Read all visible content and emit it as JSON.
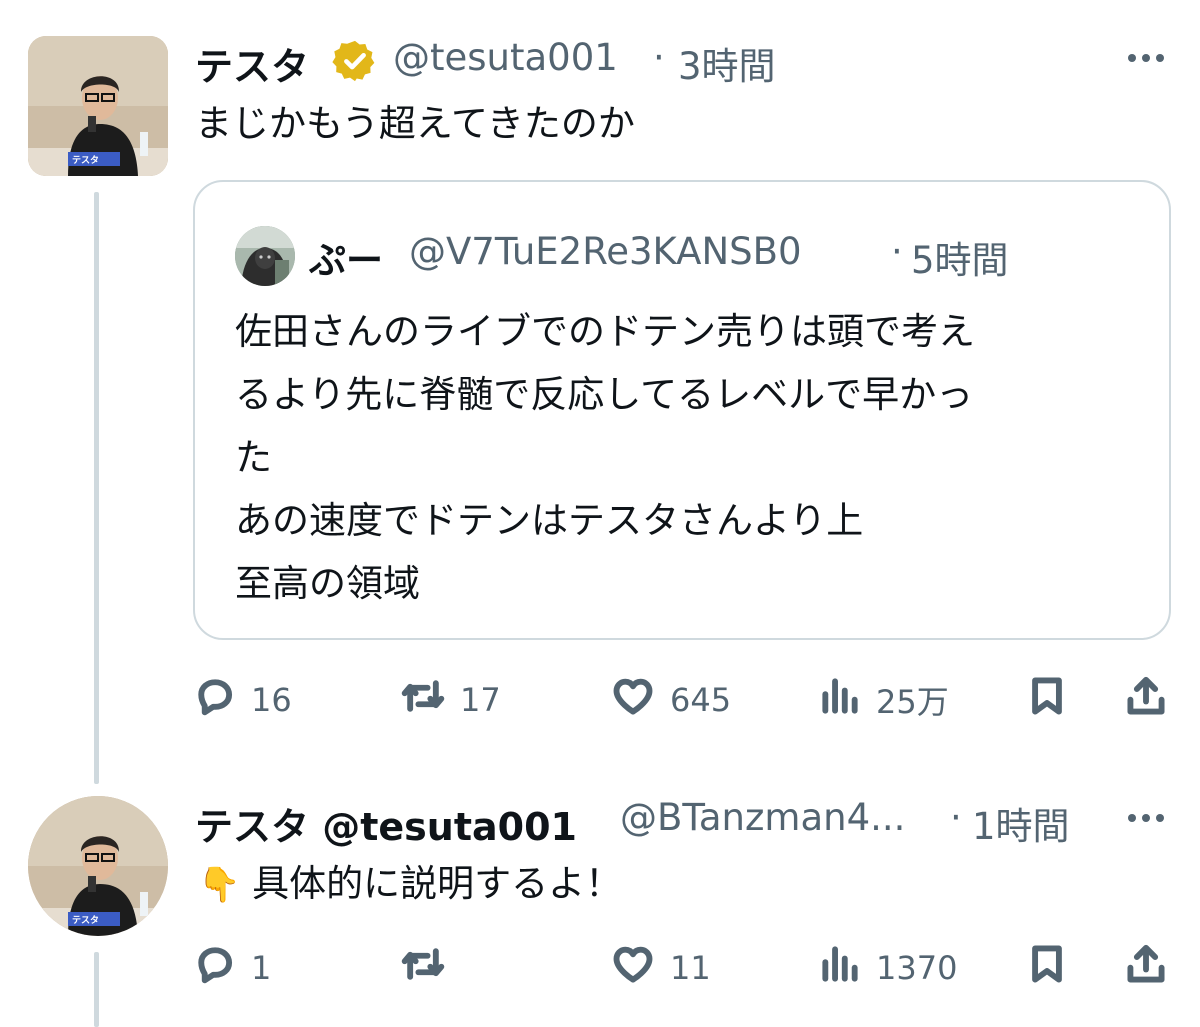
{
  "tweet1": {
    "name": "テスタ",
    "handle": "@tesuta001",
    "separator": "·",
    "time": "3時間",
    "text": "まじかもう超えてきたのか",
    "avatar_label": "テスタ",
    "quote": {
      "name": "ぷー",
      "handle": "@V7TuE2Re3KANSB0",
      "separator": "·",
      "time": "5時間",
      "lines": [
        "佐田さんのライブでのドテン売りは頭で考え",
        "るより先に脊髄で反応してるレベルで早かっ",
        "た",
        "あの速度でドテンはテスタさんより上",
        "至高の領域"
      ]
    },
    "actions": {
      "replies": "16",
      "retweets": "17",
      "likes": "645",
      "views": "25万"
    }
  },
  "tweet2": {
    "name": "テスタ @tesuta001",
    "handle": "@BTanzman4...",
    "separator": "·",
    "time": "1時間",
    "text": "具体的に説明するよ！",
    "emoji": "👇",
    "avatar_label": "テスタ",
    "actions": {
      "replies": "1",
      "retweets": "",
      "likes": "11",
      "views": "1370"
    }
  },
  "icons": {
    "verified": "verified-badge-icon",
    "more": "more-options-icon",
    "reply": "reply-icon",
    "retweet": "retweet-icon",
    "like": "heart-icon",
    "views": "views-icon",
    "bookmark": "bookmark-icon",
    "share": "share-icon"
  },
  "colors": {
    "text": "#0f1419",
    "secondary": "#536471",
    "border": "#cfd9de",
    "verified_gold": "#e2b719"
  }
}
